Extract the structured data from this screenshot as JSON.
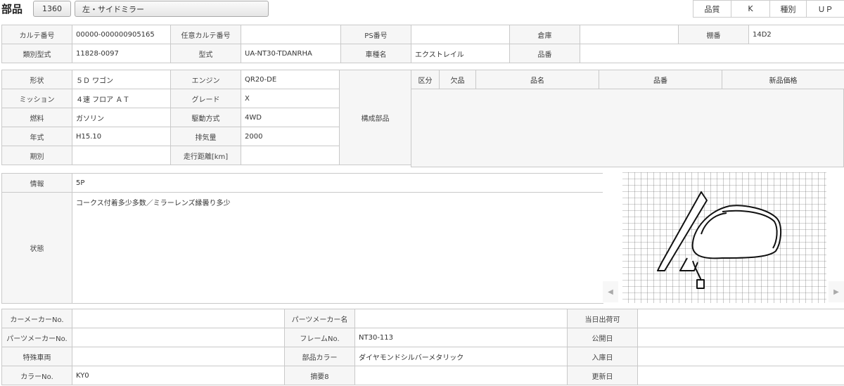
{
  "header": {
    "title": "部品",
    "code": "1360",
    "name": "左・サイドミラー",
    "quality_label": "品質",
    "quality_value": "K",
    "kind_label": "種別",
    "kind_value": "ＵＰ"
  },
  "info1": {
    "karte_label": "カルテ番号",
    "karte_value": "00000-000000905165",
    "any_karte_label": "任意カルテ番号",
    "any_karte_value": "",
    "ps_label": "PS番号",
    "ps_value": "",
    "warehouse_label": "倉庫",
    "warehouse_value": "",
    "shelf_label": "棚番",
    "shelf_value": "14D2",
    "class_label": "類別型式",
    "class_value": "11828-0097",
    "model_label": "型式",
    "model_value": "UA-NT30-TDANRHA",
    "car_label": "車種名",
    "car_value": "エクストレイル",
    "partno_label": "品番",
    "partno_value": ""
  },
  "info2": {
    "shape_label": "形状",
    "shape_value": "５Ｄ ワゴン",
    "engine_label": "エンジン",
    "engine_value": "QR20-DE",
    "mission_label": "ミッション",
    "mission_value": "４速 フロア ＡＴ",
    "grade_label": "グレード",
    "grade_value": "X",
    "fuel_label": "燃料",
    "fuel_value": "ガソリン",
    "drive_label": "駆動方式",
    "drive_value": "4WD",
    "year_label": "年式",
    "year_value": "H15.10",
    "displacement_label": "排気量",
    "displacement_value": "2000",
    "period_label": "期別",
    "period_value": "",
    "mileage_label": "走行距離[km]",
    "mileage_value": "",
    "components_label": "構成部品"
  },
  "components": {
    "headers": [
      "区分",
      "欠品",
      "品名",
      "品番",
      "新品価格"
    ]
  },
  "notes": {
    "info_label": "情報",
    "info_value": "5P",
    "state_label": "状態",
    "state_value": "コークス付着多少多数／ミラーレンズ縁曇り多少"
  },
  "info3": {
    "car_maker_label": "カーメーカーNo.",
    "car_maker_value": "",
    "parts_maker_label": "パーツメーカー名",
    "parts_maker_value": "",
    "same_day_label": "当日出荷可",
    "same_day_value": "",
    "parts_maker_no_label": "パーツメーカーNo.",
    "parts_maker_no_value": "",
    "frame_label": "フレームNo.",
    "frame_value": "NT30-113",
    "public_label": "公開日",
    "public_value": "",
    "special_label": "特殊車両",
    "special_value": "",
    "color_part_label": "部品カラー",
    "color_part_value": "ダイヤモンドシルバーメタリック",
    "stock_label": "入庫日",
    "stock_value": "",
    "color_no_label": "カラーNo.",
    "color_no_value": "KY0",
    "summary_label": "摘要8",
    "summary_value": "",
    "update_label": "更新日",
    "update_value": ""
  },
  "icons": {
    "prev": "chevron-left-icon",
    "next": "chevron-right-icon"
  }
}
